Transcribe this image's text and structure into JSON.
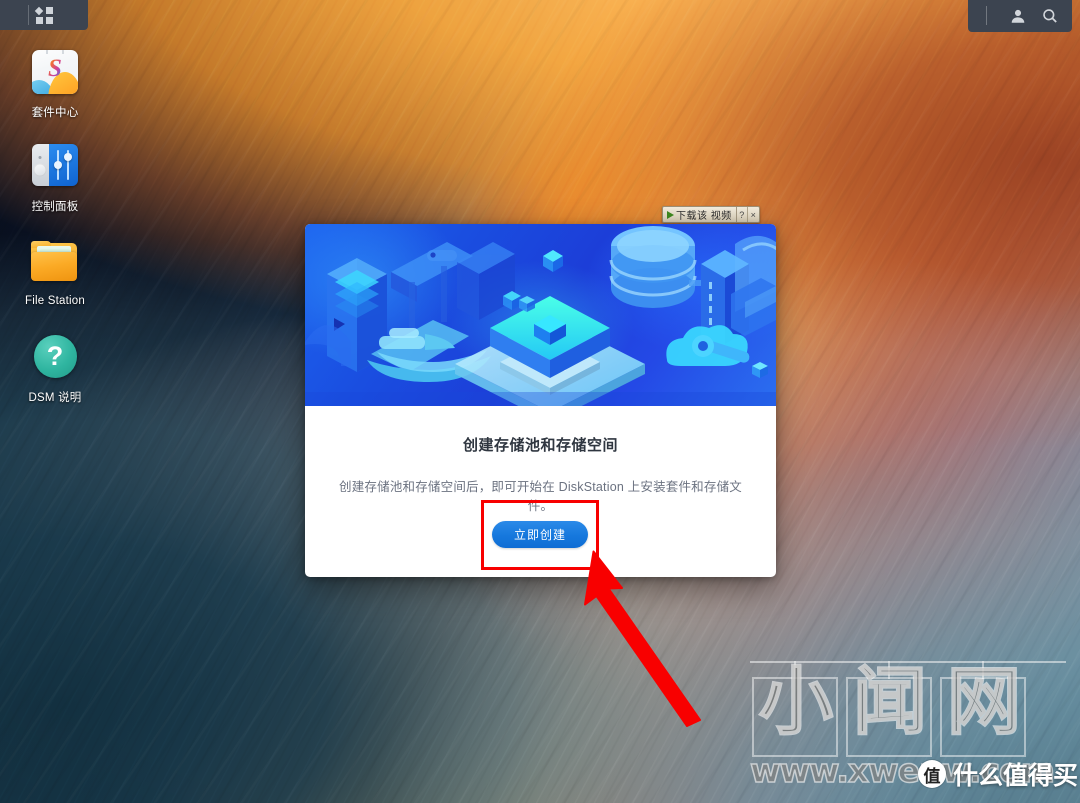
{
  "taskbar": {
    "left": {
      "menu_icon": "apps-grid-icon"
    },
    "right": {
      "user_icon": "user-icon",
      "search_icon": "search-icon"
    }
  },
  "desktop": {
    "icons": [
      {
        "label": "套件中心",
        "icon": "package-center-icon"
      },
      {
        "label": "控制面板",
        "icon": "control-panel-icon"
      },
      {
        "label": "File Station",
        "icon": "folder-icon"
      },
      {
        "label": "DSM 说明",
        "icon": "help-question-icon",
        "glyph": "?"
      }
    ]
  },
  "video_download_bar": {
    "play_icon": "play-triangle-icon",
    "label": "下载该 视频",
    "help_label": "?",
    "close_label": "×"
  },
  "dialog": {
    "illustration": "isometric-storage-illustration",
    "title": "创建存储池和存储空间",
    "description": "创建存储池和存储空间后，即可开始在 DiskStation 上安装套件和存储文件。",
    "primary_button": "立即创建",
    "annotation": {
      "highlight_box_color": "#f80000",
      "arrow_color": "#f80000",
      "arrow_icon": "up-left-arrow-icon"
    }
  },
  "watermarks": {
    "site_chars": [
      "小",
      "闻",
      "网"
    ],
    "site_url": "www.xwenw.com",
    "smzdm_badge": "值",
    "smzdm_text": "什么值得买"
  },
  "colors": {
    "accent_blue": "#1678dd",
    "taskbar": "#3c4450",
    "dialog_bg": "#ffffff",
    "title_text": "#2f3640",
    "desc_text": "#6b7280",
    "highlight_red": "#f80000"
  }
}
